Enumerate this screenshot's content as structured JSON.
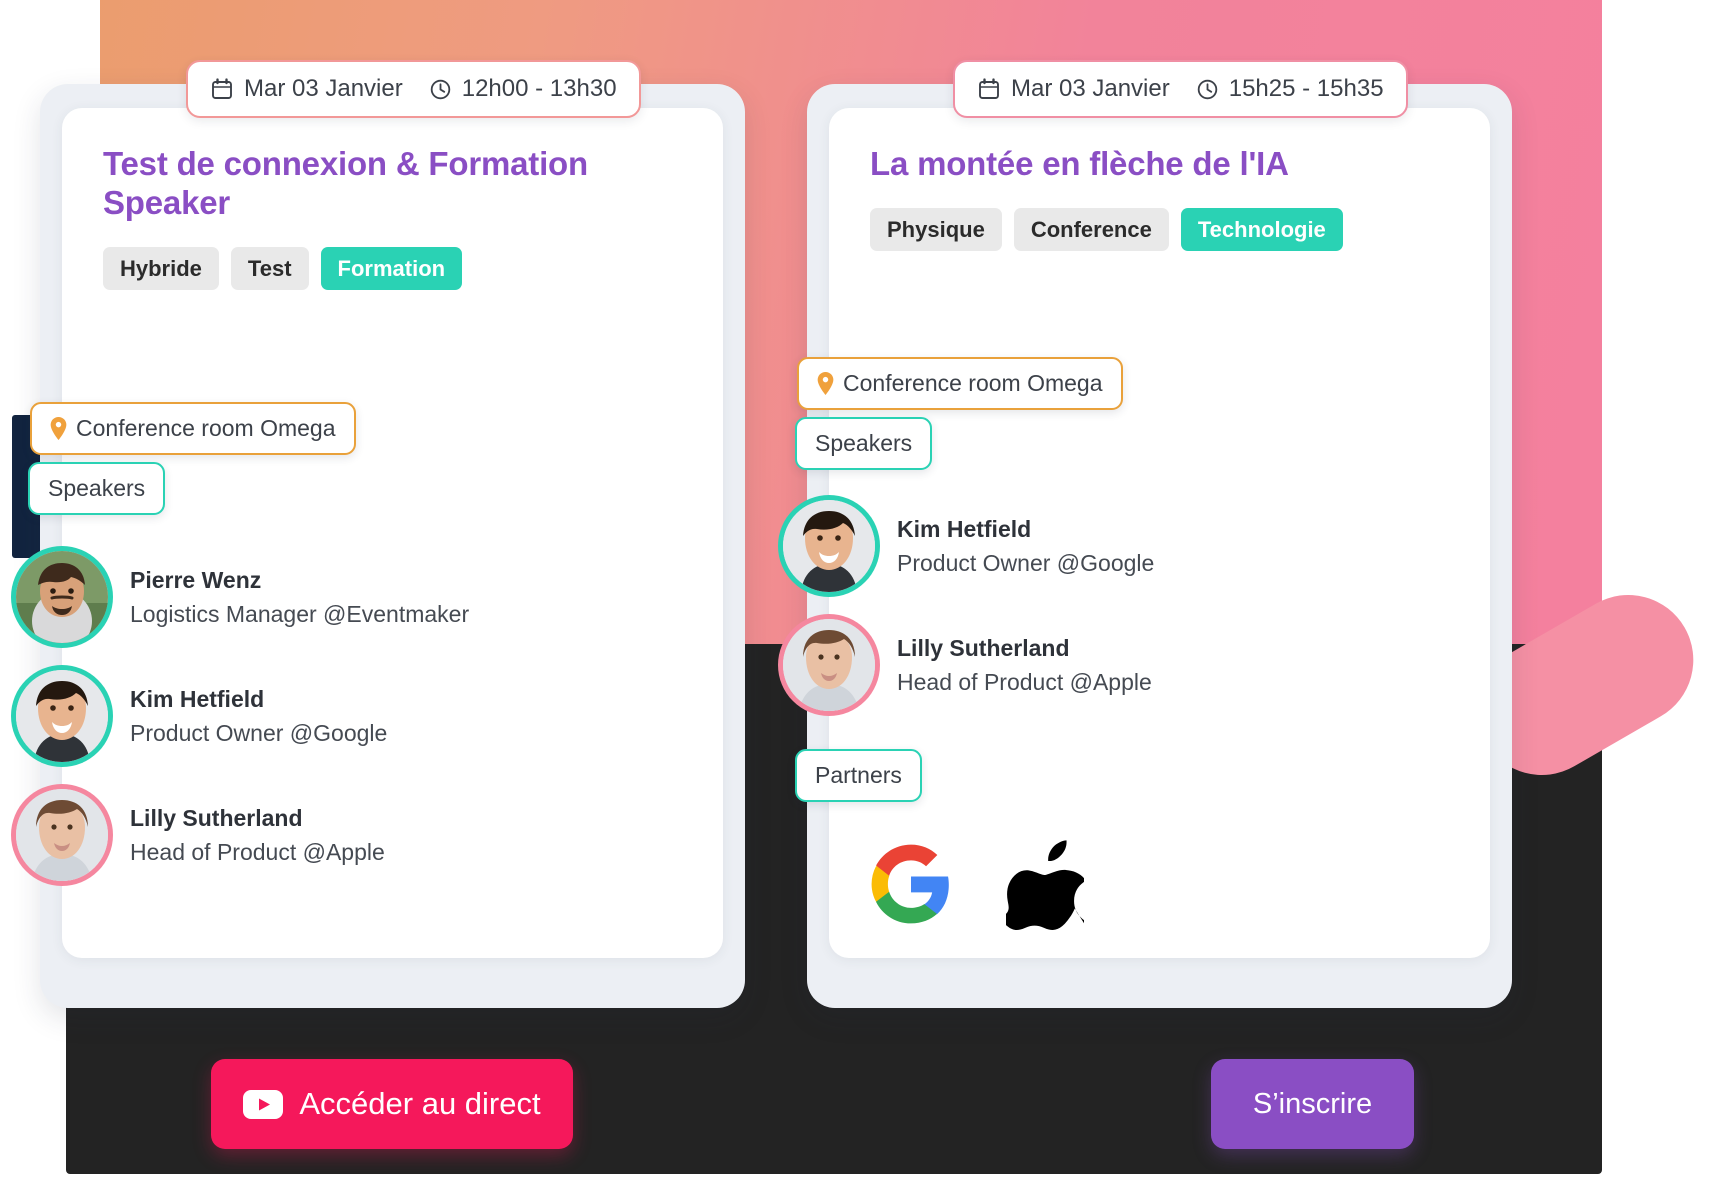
{
  "theme": {
    "accent_purple": "#8a4ec4",
    "accent_teal": "#2ad2b4",
    "accent_pink": "#f5879f",
    "accent_orange": "#e9a13b",
    "live_button": "#f5185b",
    "dark_panel": "#232323",
    "gradient_from": "#eb9d6e",
    "gradient_to": "#f4809e"
  },
  "sessions": [
    {
      "date": "Mar 03 Janvier",
      "time": "12h00 - 13h30",
      "calendar_icon": "calendar-icon",
      "clock_icon": "clock-icon",
      "title": "Test de connexion & Formation Speaker",
      "tags": [
        {
          "label": "Hybride",
          "style": "gray"
        },
        {
          "label": "Test",
          "style": "gray"
        },
        {
          "label": "Formation",
          "style": "teal"
        }
      ],
      "location_icon": "map-pin-icon",
      "location": "Conference room Omega",
      "speakers_label": "Speakers",
      "speakers": [
        {
          "name": "Pierre Wenz",
          "role": "Logistics Manager @Eventmaker",
          "ring": "teal",
          "avatar": "avatar-pierre"
        },
        {
          "name": "Kim Hetfield",
          "role": "Product Owner @Google",
          "ring": "teal",
          "avatar": "avatar-kim"
        },
        {
          "name": "Lilly Sutherland",
          "role": "Head of Product @Apple",
          "ring": "pink",
          "avatar": "avatar-lilly"
        }
      ],
      "cta": {
        "label": "Accéder au direct",
        "icon": "youtube-icon"
      }
    },
    {
      "date": "Mar 03 Janvier",
      "time": "15h25 - 15h35",
      "calendar_icon": "calendar-icon",
      "clock_icon": "clock-icon",
      "title": "La montée en flèche de l'IA",
      "tags": [
        {
          "label": "Physique",
          "style": "gray"
        },
        {
          "label": "Conference",
          "style": "gray"
        },
        {
          "label": "Technologie",
          "style": "teal"
        }
      ],
      "location_icon": "map-pin-icon",
      "location": "Conference room Omega",
      "speakers_label": "Speakers",
      "speakers": [
        {
          "name": "Kim Hetfield",
          "role": "Product Owner @Google",
          "ring": "teal",
          "avatar": "avatar-kim"
        },
        {
          "name": "Lilly Sutherland",
          "role": "Head of Product @Apple",
          "ring": "pink",
          "avatar": "avatar-lilly"
        }
      ],
      "partners_label": "Partners",
      "partners": [
        {
          "name": "Google",
          "icon": "google-logo"
        },
        {
          "name": "Apple",
          "icon": "apple-logo"
        }
      ],
      "cta": {
        "label": "S’inscrire"
      }
    }
  ]
}
